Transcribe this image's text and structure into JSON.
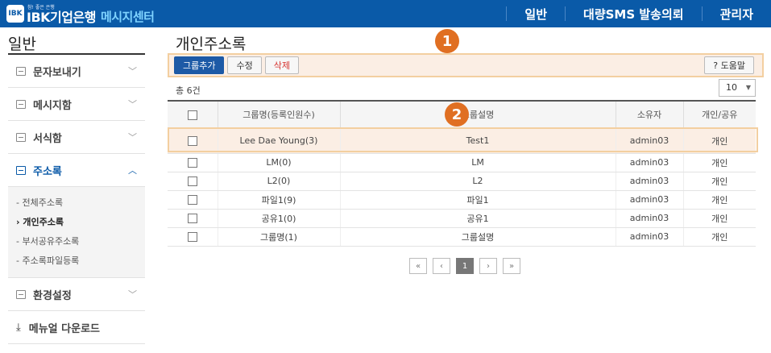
{
  "header": {
    "logo_badge": "IBK",
    "logo_tiny": "참! 좋은 은행",
    "logo_main": "IBK기업은행",
    "logo_sub": "메시지센터",
    "nav": [
      {
        "label": "일반"
      },
      {
        "label": "대량SMS 발송의뢰"
      },
      {
        "label": "관리자"
      }
    ]
  },
  "sidebar": {
    "title": "일반",
    "items": [
      {
        "label": "문자보내기"
      },
      {
        "label": "메시지함"
      },
      {
        "label": "서식함"
      },
      {
        "label": "주소록"
      },
      {
        "label": "환경설정"
      },
      {
        "label": "메뉴얼 다운로드"
      }
    ],
    "submenu": [
      {
        "label": "- 전체주소록"
      },
      {
        "label": "› 개인주소록"
      },
      {
        "label": "- 부서공유주소록"
      },
      {
        "label": "- 주소록파일등록"
      }
    ]
  },
  "main": {
    "title": "개인주소록",
    "toolbar": {
      "add_group": "그룹추가",
      "edit": "수정",
      "delete": "삭제",
      "help": "? 도움말"
    },
    "callouts": [
      "1",
      "2"
    ],
    "count_label": "총 6건",
    "page_size": "10",
    "columns": [
      "그룹명(등록인원수)",
      "그룹설명",
      "소유자",
      "개인/공유"
    ],
    "rows": [
      {
        "name": "Lee Dae Young(3)",
        "desc": "Test1",
        "owner": "admin03",
        "type": "개인"
      },
      {
        "name": "LM(0)",
        "desc": "LM",
        "owner": "admin03",
        "type": "개인"
      },
      {
        "name": "L2(0)",
        "desc": "L2",
        "owner": "admin03",
        "type": "개인"
      },
      {
        "name": "파일1(9)",
        "desc": "파일1",
        "owner": "admin03",
        "type": "개인"
      },
      {
        "name": "공유1(0)",
        "desc": "공유1",
        "owner": "admin03",
        "type": "개인"
      },
      {
        "name": "그룹명(1)",
        "desc": "그룹설명",
        "owner": "admin03",
        "type": "개인"
      }
    ],
    "pager": {
      "first": "«",
      "prev": "‹",
      "current": "1",
      "next": "›",
      "last": "»"
    }
  },
  "colors": {
    "header_bg": "#0a5aa8",
    "accent_orange": "#e06f22",
    "highlight_bg": "#fbeee4",
    "primary_button": "#1d5aa6"
  }
}
